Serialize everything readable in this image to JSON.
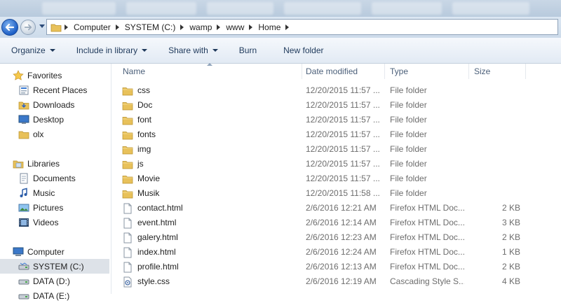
{
  "address": {
    "crumbs": [
      "Computer",
      "SYSTEM (C:)",
      "wamp",
      "www",
      "Home"
    ]
  },
  "toolbar": {
    "organize": "Organize",
    "include_in_library": "Include in library",
    "share_with": "Share with",
    "burn": "Burn",
    "new_folder": "New folder"
  },
  "nav": {
    "favorites": {
      "label": "Favorites",
      "items": [
        "Recent Places",
        "Downloads",
        "Desktop",
        "olx"
      ]
    },
    "libraries": {
      "label": "Libraries",
      "items": [
        "Documents",
        "Music",
        "Pictures",
        "Videos"
      ]
    },
    "computer": {
      "label": "Computer",
      "items": [
        "SYSTEM (C:)",
        "DATA (D:)",
        "DATA (E:)"
      ]
    }
  },
  "columns": {
    "name": "Name",
    "date": "Date modified",
    "type": "Type",
    "size": "Size"
  },
  "files": [
    {
      "name": "css",
      "date": "12/20/2015 11:57 ...",
      "type": "File folder",
      "size": "",
      "kind": "folder"
    },
    {
      "name": "Doc",
      "date": "12/20/2015 11:57 ...",
      "type": "File folder",
      "size": "",
      "kind": "folder"
    },
    {
      "name": "font",
      "date": "12/20/2015 11:57 ...",
      "type": "File folder",
      "size": "",
      "kind": "folder"
    },
    {
      "name": "fonts",
      "date": "12/20/2015 11:57 ...",
      "type": "File folder",
      "size": "",
      "kind": "folder"
    },
    {
      "name": "img",
      "date": "12/20/2015 11:57 ...",
      "type": "File folder",
      "size": "",
      "kind": "folder"
    },
    {
      "name": "js",
      "date": "12/20/2015 11:57 ...",
      "type": "File folder",
      "size": "",
      "kind": "folder"
    },
    {
      "name": "Movie",
      "date": "12/20/2015 11:57 ...",
      "type": "File folder",
      "size": "",
      "kind": "folder"
    },
    {
      "name": "Musik",
      "date": "12/20/2015 11:58 ...",
      "type": "File folder",
      "size": "",
      "kind": "folder"
    },
    {
      "name": "contact.html",
      "date": "2/6/2016 12:21 AM",
      "type": "Firefox HTML Doc...",
      "size": "2 KB",
      "kind": "file"
    },
    {
      "name": "event.html",
      "date": "2/6/2016 12:14 AM",
      "type": "Firefox HTML Doc...",
      "size": "3 KB",
      "kind": "file"
    },
    {
      "name": "galery.html",
      "date": "2/6/2016 12:23 AM",
      "type": "Firefox HTML Doc...",
      "size": "2 KB",
      "kind": "file"
    },
    {
      "name": "index.html",
      "date": "2/6/2016 12:24 AM",
      "type": "Firefox HTML Doc...",
      "size": "1 KB",
      "kind": "file"
    },
    {
      "name": "profile.html",
      "date": "2/6/2016 12:13 AM",
      "type": "Firefox HTML Doc...",
      "size": "2 KB",
      "kind": "file"
    },
    {
      "name": "style.css",
      "date": "2/6/2016 12:19 AM",
      "type": "Cascading Style S...",
      "size": "4 KB",
      "kind": "css"
    }
  ],
  "colors": {
    "accent": "#1e395b",
    "folder": "#e8c15a",
    "selected": "#dde2e8"
  }
}
